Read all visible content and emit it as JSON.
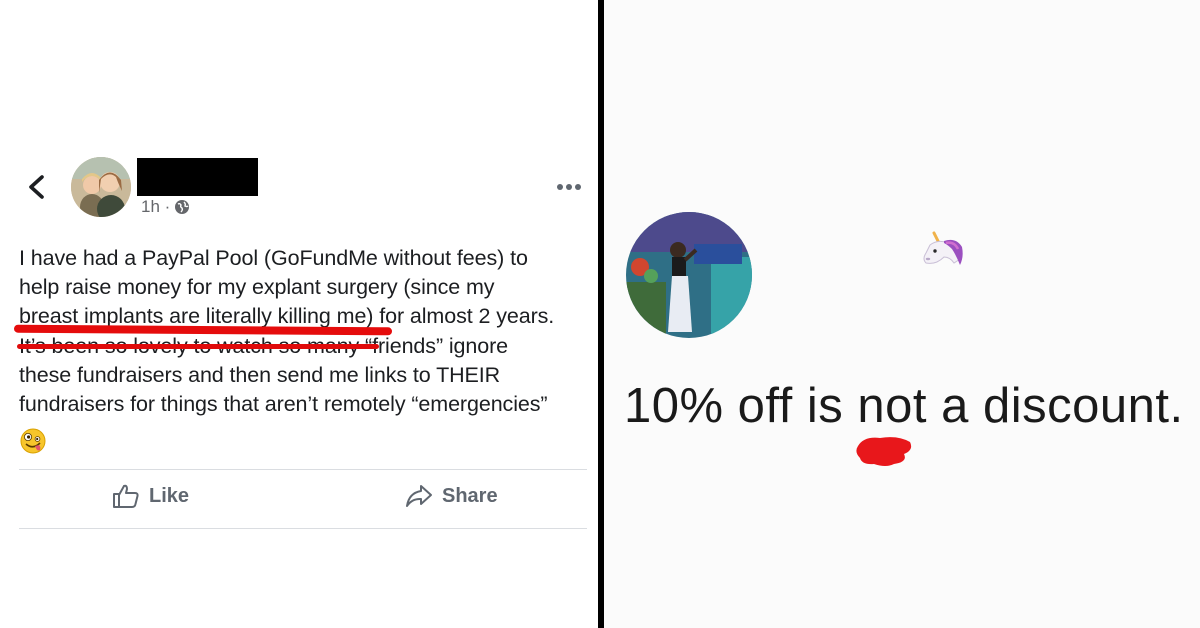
{
  "left_post": {
    "timestamp": "1h ·",
    "icons": {
      "back": "chevron-left-icon",
      "privacy": "globe-icon",
      "more": "more-horizontal-icon",
      "emoji": "zany-face-icon"
    },
    "text_lines": [
      "I have had a PayPal Pool (GoFundMe without fees) to",
      "help raise money for my explant surgery (since my",
      "breast implants are literally killing me) for almost 2 years.",
      "It’s been so lovely to watch so many “friends” ignore",
      "these fundraisers and then send me links to THEIR",
      "fundraisers for things that aren’t remotely “emergencies”"
    ],
    "actions": {
      "like_label": "Like",
      "share_label": "Share"
    },
    "annotation_color": "#e50c0c"
  },
  "right_post": {
    "quote": "10% off is not a discount.",
    "icons": {
      "decoration": "unicorn-icon"
    },
    "annotation_color": "#e8171b"
  },
  "colors": {
    "text": "#1c1e21",
    "secondary_text": "#65676b",
    "action_text": "#606770",
    "divider": "#000000"
  }
}
